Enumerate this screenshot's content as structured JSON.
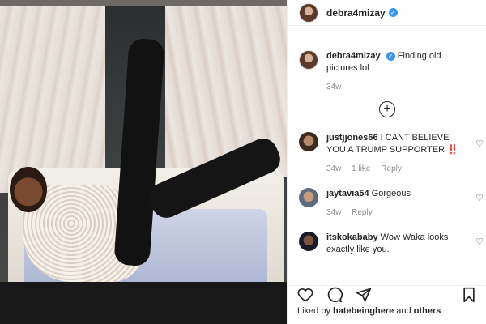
{
  "post": {
    "author": "debra4mizay",
    "caption": "Finding old pictures lol",
    "caption_age": "34w"
  },
  "comments": [
    {
      "user": "justjjones66",
      "text": "I CANT BELIEVE YOU A TRUMP SUPPORTER ‼️",
      "age": "34w",
      "likes": "1 like",
      "reply": "Reply"
    },
    {
      "user": "jaytavia54",
      "text": "Gorgeous",
      "age": "34w",
      "reply": "Reply"
    },
    {
      "user": "itskokababy",
      "text": "Wow Waka looks exactly like you."
    }
  ],
  "likes_line": {
    "prefix": "Liked by",
    "user": "hatebeinghere",
    "connector": "and",
    "suffix": "others"
  },
  "icons": {
    "verified": "verified-badge-icon",
    "load_more": "plus-circle-icon",
    "like": "heart-icon",
    "comment": "comment-icon",
    "share": "share-icon",
    "save": "bookmark-icon"
  }
}
